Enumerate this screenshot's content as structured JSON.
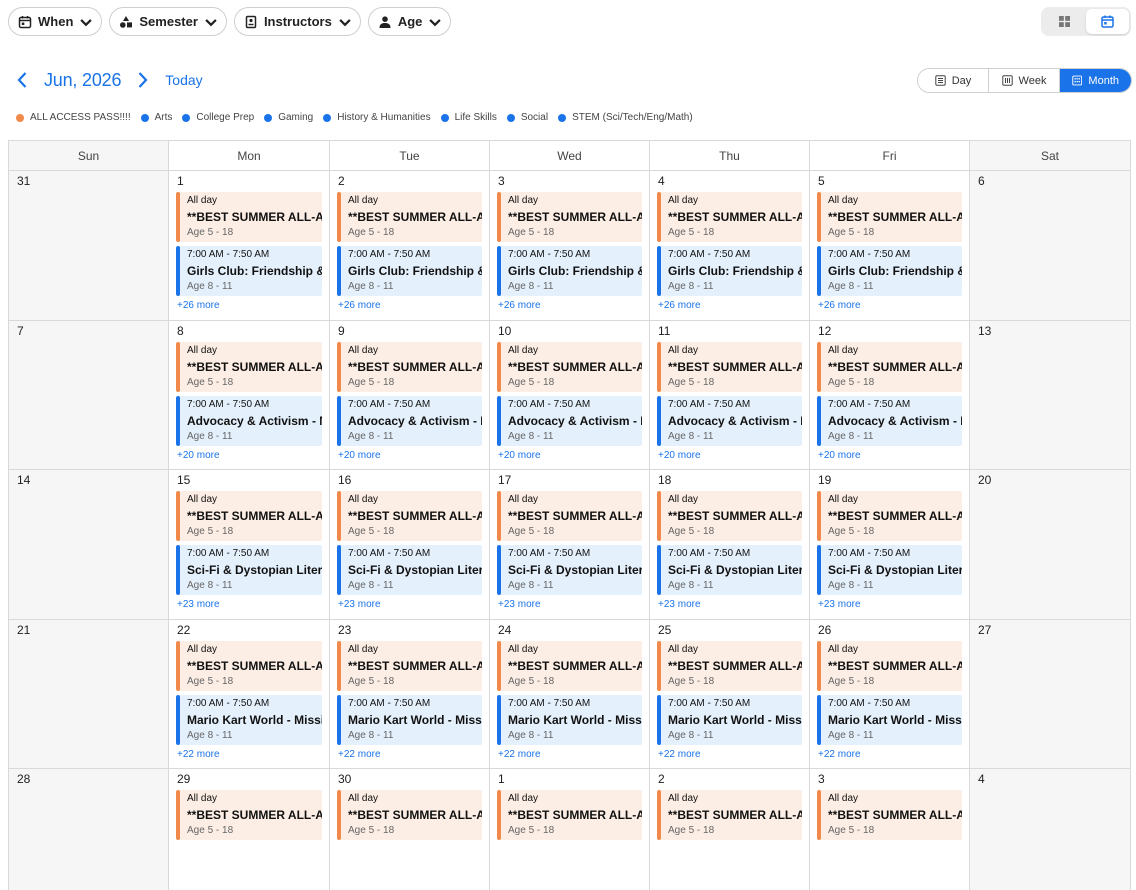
{
  "filters": [
    {
      "label": "When",
      "icon": "calendar-icon"
    },
    {
      "label": "Semester",
      "icon": "shapes-icon"
    },
    {
      "label": "Instructors",
      "icon": "badge-icon"
    },
    {
      "label": "Age",
      "icon": "person-icon"
    }
  ],
  "nav": {
    "month_title": "Jun, 2026",
    "today_label": "Today"
  },
  "range": {
    "day": "Day",
    "week": "Week",
    "month": "Month",
    "active": "month"
  },
  "legend": [
    {
      "label": "ALL ACCESS PASS!!!!",
      "color": "#f0894a"
    },
    {
      "label": "Arts",
      "color": "#1a73e8"
    },
    {
      "label": "College Prep",
      "color": "#1a73e8"
    },
    {
      "label": "Gaming",
      "color": "#1a73e8"
    },
    {
      "label": "History & Humanities",
      "color": "#1a73e8"
    },
    {
      "label": "Life Skills",
      "color": "#1a73e8"
    },
    {
      "label": "Social",
      "color": "#1a73e8"
    },
    {
      "label": "STEM (Sci/Tech/Eng/Math)",
      "color": "#1a73e8"
    }
  ],
  "weekdays": [
    "Sun",
    "Mon",
    "Tue",
    "Wed",
    "Thu",
    "Fri",
    "Sat"
  ],
  "allday_event": {
    "time": "All day",
    "title": "**BEST SUMMER ALL-ACCESS PASS",
    "age": "Age 5 - 18"
  },
  "weeks": [
    {
      "days": [
        "31",
        "1",
        "2",
        "3",
        "4",
        "5",
        "6"
      ],
      "morning_event": {
        "time": "7:00 AM - 7:50 AM",
        "title": "Girls Club: Friendship & Fun",
        "age": "Age 8 - 11"
      },
      "more": "+26 more"
    },
    {
      "days": [
        "7",
        "8",
        "9",
        "10",
        "11",
        "12",
        "13"
      ],
      "morning_event": {
        "time": "7:00 AM - 7:50 AM",
        "title": "Advocacy & Activism - Make a Difference",
        "age": "Age 8 - 11"
      },
      "more": "+20 more"
    },
    {
      "days": [
        "14",
        "15",
        "16",
        "17",
        "18",
        "19",
        "20"
      ],
      "morning_event": {
        "time": "7:00 AM - 7:50 AM",
        "title": "Sci-Fi & Dystopian Literature",
        "age": "Age 8 - 11"
      },
      "more": "+23 more"
    },
    {
      "days": [
        "21",
        "22",
        "23",
        "24",
        "25",
        "26",
        "27"
      ],
      "morning_event": {
        "time": "7:00 AM - 7:50 AM",
        "title": "Mario Kart World - Mission Mode",
        "age": "Age 8 - 11"
      },
      "more": "+22 more"
    },
    {
      "days": [
        "28",
        "29",
        "30",
        "1",
        "2",
        "3",
        "4"
      ],
      "morning_event": null,
      "more": null
    }
  ],
  "colors": {
    "accent": "#1a73e8",
    "allaccess": "#f0894a",
    "orange_bg": "#fdeee5",
    "blue_bg": "#e4f0fc"
  }
}
